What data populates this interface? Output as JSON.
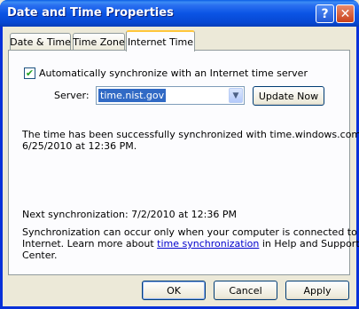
{
  "window": {
    "title": "Date and Time Properties",
    "help_glyph": "?",
    "close_glyph": "✕"
  },
  "tabs": [
    {
      "label": "Date & Time"
    },
    {
      "label": "Time Zone"
    },
    {
      "label": "Internet Time",
      "active": true
    }
  ],
  "sync": {
    "checkbox_checked": true,
    "checkbox_label": "Automatically synchronize with an Internet time server",
    "server_label": "Server:",
    "server_value": "time.nist.gov",
    "update_button": "Update Now",
    "status_line1": "The time has been successfully synchronized with time.windows.com on",
    "status_line2": "6/25/2010 at 12:36 PM.",
    "next_sync": "Next synchronization: 7/2/2010 at 12:36 PM",
    "note_line1": "Synchronization can occur only when your computer is connected to the",
    "note_line2_prefix": "Internet.  Learn more about ",
    "note_link": "time synchronization",
    "note_line2_suffix": " in Help and Support",
    "note_line3": "Center."
  },
  "buttons": {
    "ok": "OK",
    "cancel": "Cancel",
    "apply": "Apply"
  }
}
